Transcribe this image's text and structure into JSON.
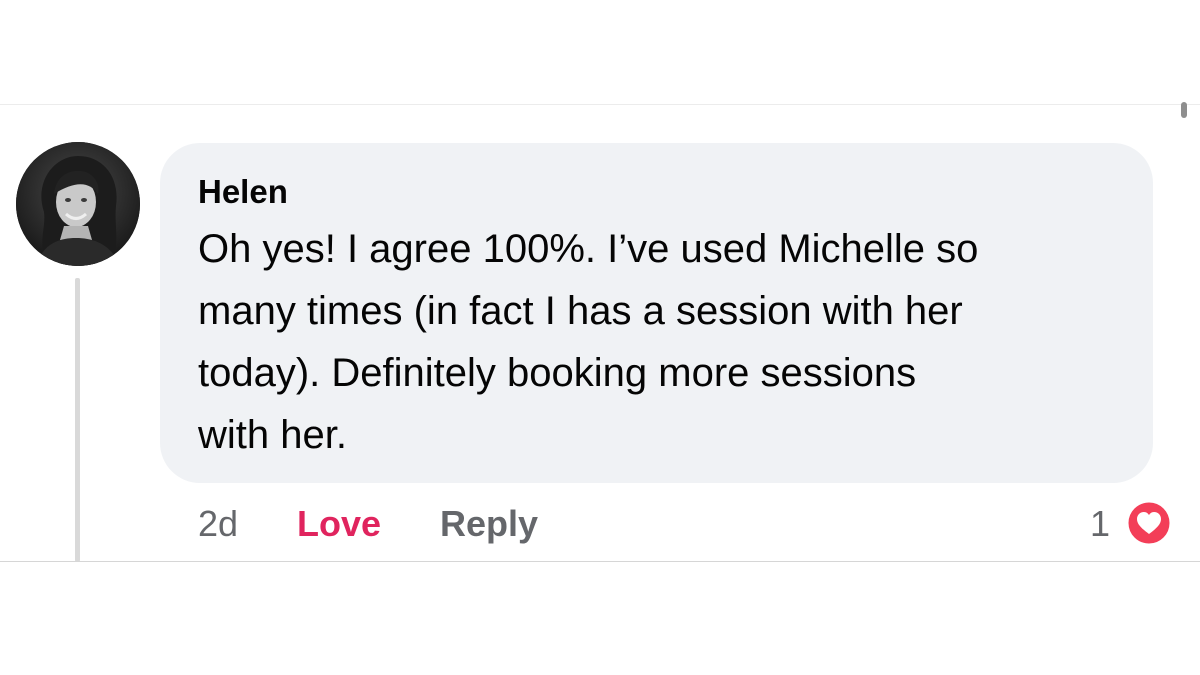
{
  "comment": {
    "author": "Helen",
    "text_lines": [
      "Oh yes! I agree 100%. I’ve used Michelle so",
      "many times (in fact I has a session with her",
      "today). Definitely booking more sessions",
      "with her."
    ],
    "avatar_icon": "profile-photo-avatar"
  },
  "actions": {
    "timestamp": "2d",
    "love_label": "Love",
    "reply_label": "Reply"
  },
  "reactions": {
    "count": "1",
    "icon": "heart-reaction-icon"
  },
  "colors": {
    "love_accent": "#e0245e",
    "bubble_background": "#f0f2f5",
    "secondary_text": "#65676b"
  }
}
